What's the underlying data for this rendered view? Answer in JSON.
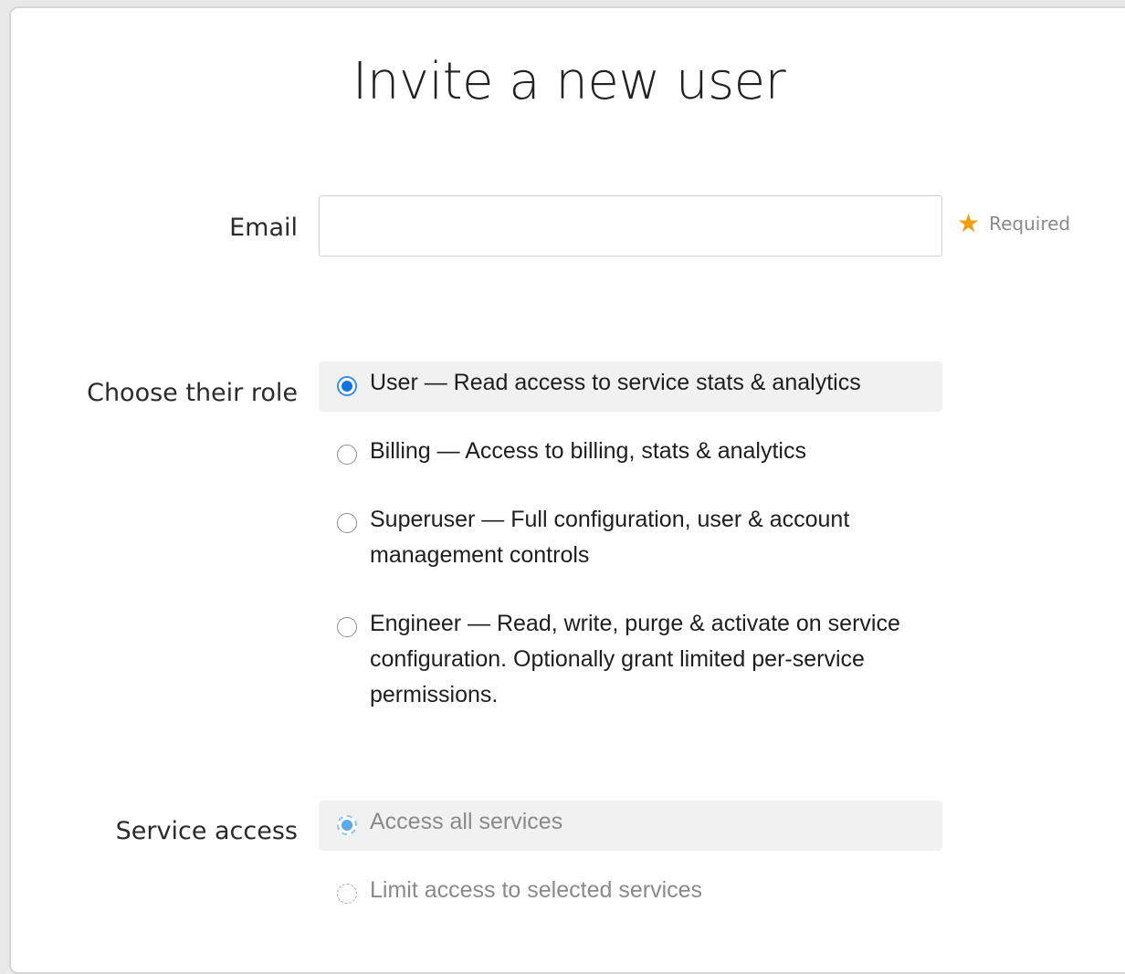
{
  "title": "Invite a new user",
  "email": {
    "label": "Email",
    "value": "",
    "placeholder": "",
    "required_label": "Required",
    "required_icon": "star-icon"
  },
  "role": {
    "label": "Choose their role",
    "options": [
      {
        "text": "User — Read access to service stats & analytics",
        "checked": true
      },
      {
        "text": "Billing — Access to billing, stats & analytics",
        "checked": false
      },
      {
        "text": "Superuser — Full configuration, user & account management controls",
        "checked": false
      },
      {
        "text": "Engineer — Read, write, purge & activate on service configuration. Optionally grant limited per-service permissions.",
        "checked": false
      }
    ]
  },
  "service_access": {
    "label": "Service access",
    "options": [
      {
        "text": "Access all services",
        "checked": true,
        "disabled": true
      },
      {
        "text": "Limit access to selected services",
        "checked": false,
        "disabled": true
      }
    ]
  },
  "colors": {
    "accent": "#1273de",
    "required_star": "#f2a012",
    "selected_bg": "#f1f1f1"
  }
}
